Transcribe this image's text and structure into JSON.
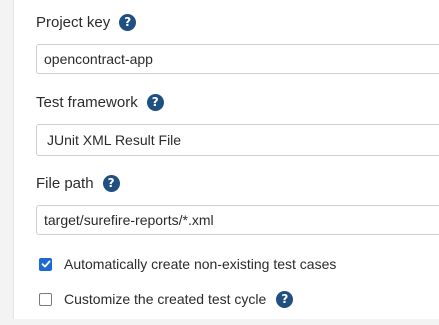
{
  "form": {
    "project_key": {
      "label": "Project key",
      "value": "opencontract-app"
    },
    "test_framework": {
      "label": "Test framework",
      "selected": "JUnit XML Result File"
    },
    "file_path": {
      "label": "File path",
      "value": "target/surefire-reports/*.xml"
    },
    "auto_create": {
      "label": "Automatically create non-existing test cases",
      "checked": true
    },
    "customize_cycle": {
      "label": "Customize the created test cycle",
      "checked": false
    }
  },
  "help_icon_glyph": "?",
  "colors": {
    "accent": "#205081",
    "checkbox_checked": "#1b68d7",
    "border": "#cfcfd1",
    "text": "#2b2b2b"
  }
}
